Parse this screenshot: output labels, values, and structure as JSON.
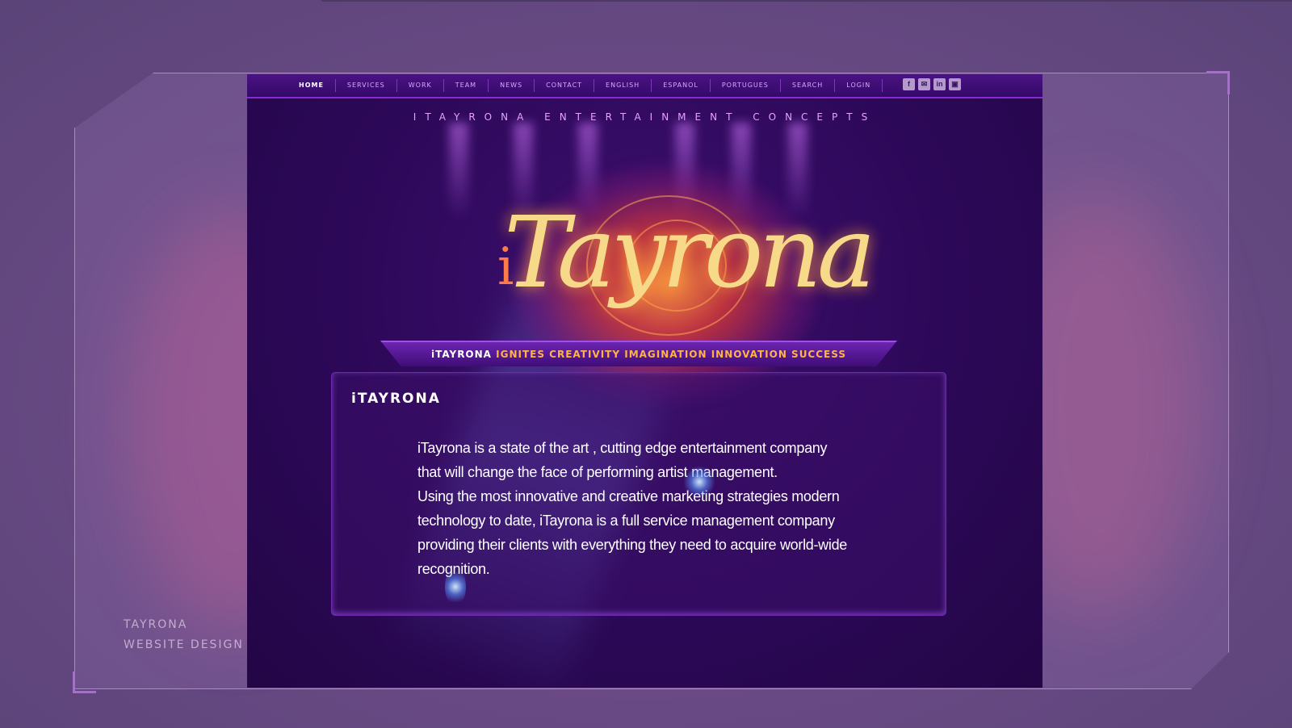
{
  "caption": {
    "line1": "TAYRONA",
    "line2": "WEBSITE DESIGN"
  },
  "nav": {
    "items": [
      "HOME",
      "SERVICES",
      "WORK",
      "TEAM",
      "NEWS",
      "CONTACT",
      "ENGLISH",
      "ESPANOL",
      "PORTUGUES",
      "SEARCH",
      "LOGIN"
    ],
    "active": "HOME"
  },
  "social": {
    "icons": [
      "facebook-icon",
      "email-icon",
      "linkedin-icon",
      "youtube-icon"
    ],
    "glyphs": [
      "f",
      "✉",
      "in",
      "▣"
    ]
  },
  "header": {
    "tagline": "ITAYRONA ENTERTAINMENT CONCEPTS"
  },
  "logo": {
    "i": "i",
    "text": "Tayrona"
  },
  "banner": {
    "brand": "iTAYRONA",
    "words": "IGNITES CREATIVITY IMAGINATION INNOVATION SUCCESS"
  },
  "panel": {
    "title": "iTAYRONA",
    "lines": [
      "iTayrona is a state of the art , cutting edge entertainment company",
      "that will change the face of performing artist management.",
      "Using the most innovative and creative marketing strategies modern",
      "technology to date, iTayrona is a full service management company",
      "providing their clients with everything they need to acquire world-wide",
      "recognition."
    ]
  },
  "colors": {
    "accent": "#8a2bd0",
    "orange": "#ffb347",
    "tagline": "#e6a3ff"
  }
}
